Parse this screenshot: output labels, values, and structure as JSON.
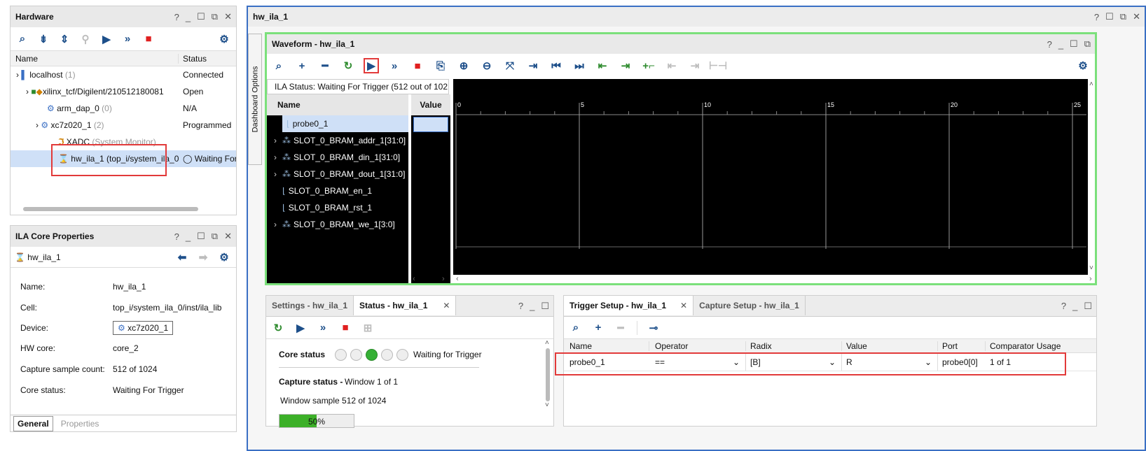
{
  "hardware": {
    "title": "Hardware",
    "columns": [
      "Name",
      "Status"
    ],
    "rows": [
      {
        "name": "localhost",
        "count": "(1)",
        "status": "Connected"
      },
      {
        "name": "xilinx_tcf/Digilent/210512180081",
        "status": "Open"
      },
      {
        "name": "arm_dap_0",
        "count": "(0)",
        "status": "N/A"
      },
      {
        "name": "xc7z020_1",
        "count": "(2)",
        "status": "Programmed"
      },
      {
        "name": "XADC",
        "sub": "(System Monitor)",
        "status": ""
      },
      {
        "name": "hw_ila_1 (top_i/system_ila_0",
        "status": "Waiting For"
      }
    ]
  },
  "props": {
    "title": "ILA Core Properties",
    "object": "hw_ila_1",
    "fields": [
      {
        "k": "Name:",
        "v": "hw_ila_1"
      },
      {
        "k": "Cell:",
        "v": "top_i/system_ila_0/inst/ila_lib"
      },
      {
        "k": "Device:",
        "v": "xc7z020_1"
      },
      {
        "k": "HW core:",
        "v": "core_2"
      },
      {
        "k": "Capture sample count:",
        "v": "512 of 1024"
      },
      {
        "k": "Core status:",
        "v": "Waiting For Trigger"
      }
    ],
    "tabs": [
      "General",
      "Properties"
    ]
  },
  "main": {
    "title": "hw_ila_1",
    "side_tab": "Dashboard Options"
  },
  "waveform": {
    "title": "Waveform - hw_ila_1",
    "status": "ILA Status:  Waiting For Trigger (512 out of 102",
    "name_header": "Name",
    "value_header": "Value",
    "signals": [
      "probe0_1",
      "SLOT_0_BRAM_addr_1[31:0]",
      "SLOT_0_BRAM_din_1[31:0]",
      "SLOT_0_BRAM_dout_1[31:0]",
      "SLOT_0_BRAM_en_1",
      "SLOT_0_BRAM_rst_1",
      "SLOT_0_BRAM_we_1[3:0]"
    ],
    "ticks": [
      "0",
      "5",
      "10",
      "15",
      "20",
      "25"
    ]
  },
  "status_panel": {
    "tabs": [
      "Settings - hw_ila_1",
      "Status - hw_ila_1"
    ],
    "core_status_label": "Core status",
    "core_status_text": "Waiting for Trigger",
    "capture_status_label": "Capture status -",
    "window": "Window 1 of 1",
    "window_sample": "Window sample 512 of 1024",
    "progress_text": "50%",
    "progress": 0.5
  },
  "trigger": {
    "tabs": [
      "Trigger Setup - hw_ila_1",
      "Capture Setup - hw_ila_1"
    ],
    "columns": [
      "Name",
      "Operator",
      "Radix",
      "Value",
      "Port",
      "Comparator Usage"
    ],
    "row": {
      "name": "probe0_1",
      "operator": "==",
      "radix": "[B]",
      "value": "R",
      "port": "probe0[0]",
      "usage": "1 of 1"
    }
  },
  "colors": {
    "accent": "#3a6fc4",
    "highlight": "#e23a3a",
    "green_border": "#7be07b"
  }
}
